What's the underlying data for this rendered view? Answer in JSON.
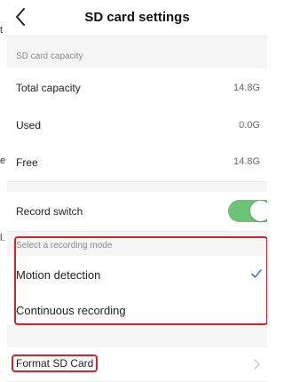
{
  "side_fragments": [
    "t",
    "e",
    "l."
  ],
  "header": {
    "title": "SD card settings"
  },
  "capacity": {
    "section_label": "SD card capacity",
    "rows": [
      {
        "label": "Total capacity",
        "value": "14.8G"
      },
      {
        "label": "Used",
        "value": "0.0G"
      },
      {
        "label": "Free",
        "value": "14.8G"
      }
    ]
  },
  "record_switch": {
    "label": "Record switch",
    "on": true
  },
  "recording_mode": {
    "section_label": "Select a recording mode",
    "options": [
      {
        "label": "Motion detection",
        "selected": true
      },
      {
        "label": "Continuous recording",
        "selected": false
      }
    ]
  },
  "format": {
    "label": "Format SD Card"
  },
  "colors": {
    "accent": "#6cc276",
    "highlight": "#d1232a",
    "check": "#2f6fd6"
  },
  "icons": {
    "back": "chevron-left-icon",
    "selected": "checkmark-icon",
    "more": "chevron-right-icon"
  }
}
